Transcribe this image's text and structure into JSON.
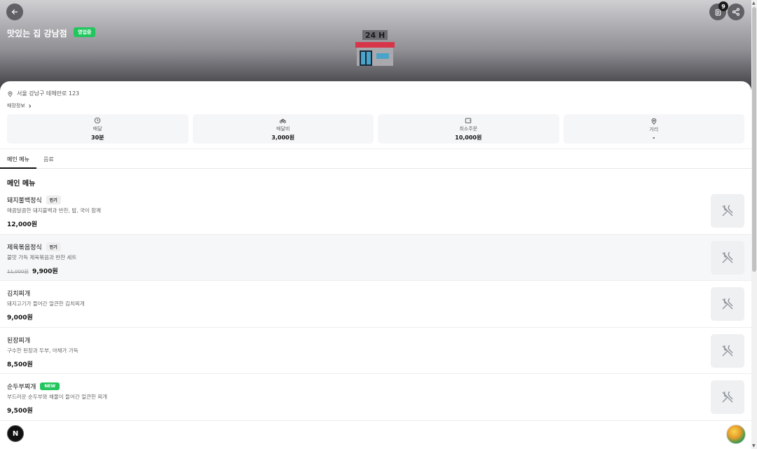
{
  "store": {
    "name": "맛있는 집 강남점",
    "status_badge": "영업중",
    "sign_text": "24 H",
    "address": "서울 강남구 테헤란로 123",
    "info_link": "매장정보",
    "order_count": "9"
  },
  "stats": [
    {
      "icon": "clock-icon",
      "label": "배달",
      "value": "30분"
    },
    {
      "icon": "bike-icon",
      "label": "배달비",
      "value": "3,000원"
    },
    {
      "icon": "wallet-icon",
      "label": "최소주문",
      "value": "10,000원"
    },
    {
      "icon": "location-pin-icon",
      "label": "거리",
      "value": "-"
    }
  ],
  "tabs": [
    {
      "label": "메인 메뉴",
      "active": true
    },
    {
      "label": "음료",
      "active": false
    }
  ],
  "section_title": "메인 메뉴",
  "menu_items": [
    {
      "name": "돼지불백정식",
      "tag": "인기",
      "tag_type": "popular",
      "desc": "매콤달콤한 돼지불백과 반찬, 밥, 국이 함께",
      "orig_price": "",
      "price": "12,000원"
    },
    {
      "name": "제육볶음정식",
      "tag": "인기",
      "tag_type": "popular",
      "desc": "불맛 가득 제육볶음과 반찬 세트",
      "orig_price": "11,000원",
      "price": "9,900원"
    },
    {
      "name": "김치찌개",
      "tag": "",
      "tag_type": "",
      "desc": "돼지고기가 들어간 얼큰한 김치찌개",
      "orig_price": "",
      "price": "9,000원"
    },
    {
      "name": "된장찌개",
      "tag": "",
      "tag_type": "",
      "desc": "구수한 된장과 두부, 야채가 가득",
      "orig_price": "",
      "price": "8,500원"
    },
    {
      "name": "순두부찌개",
      "tag": "NEW",
      "tag_type": "new",
      "desc": "부드러운 순두부와 해물이 들어간 얼큰한 찌개",
      "orig_price": "",
      "price": "9,500원"
    }
  ],
  "fab": {
    "n_label": "N"
  },
  "colors": {
    "accent_green": "#22c55e",
    "sign_red": "#d7364a"
  }
}
